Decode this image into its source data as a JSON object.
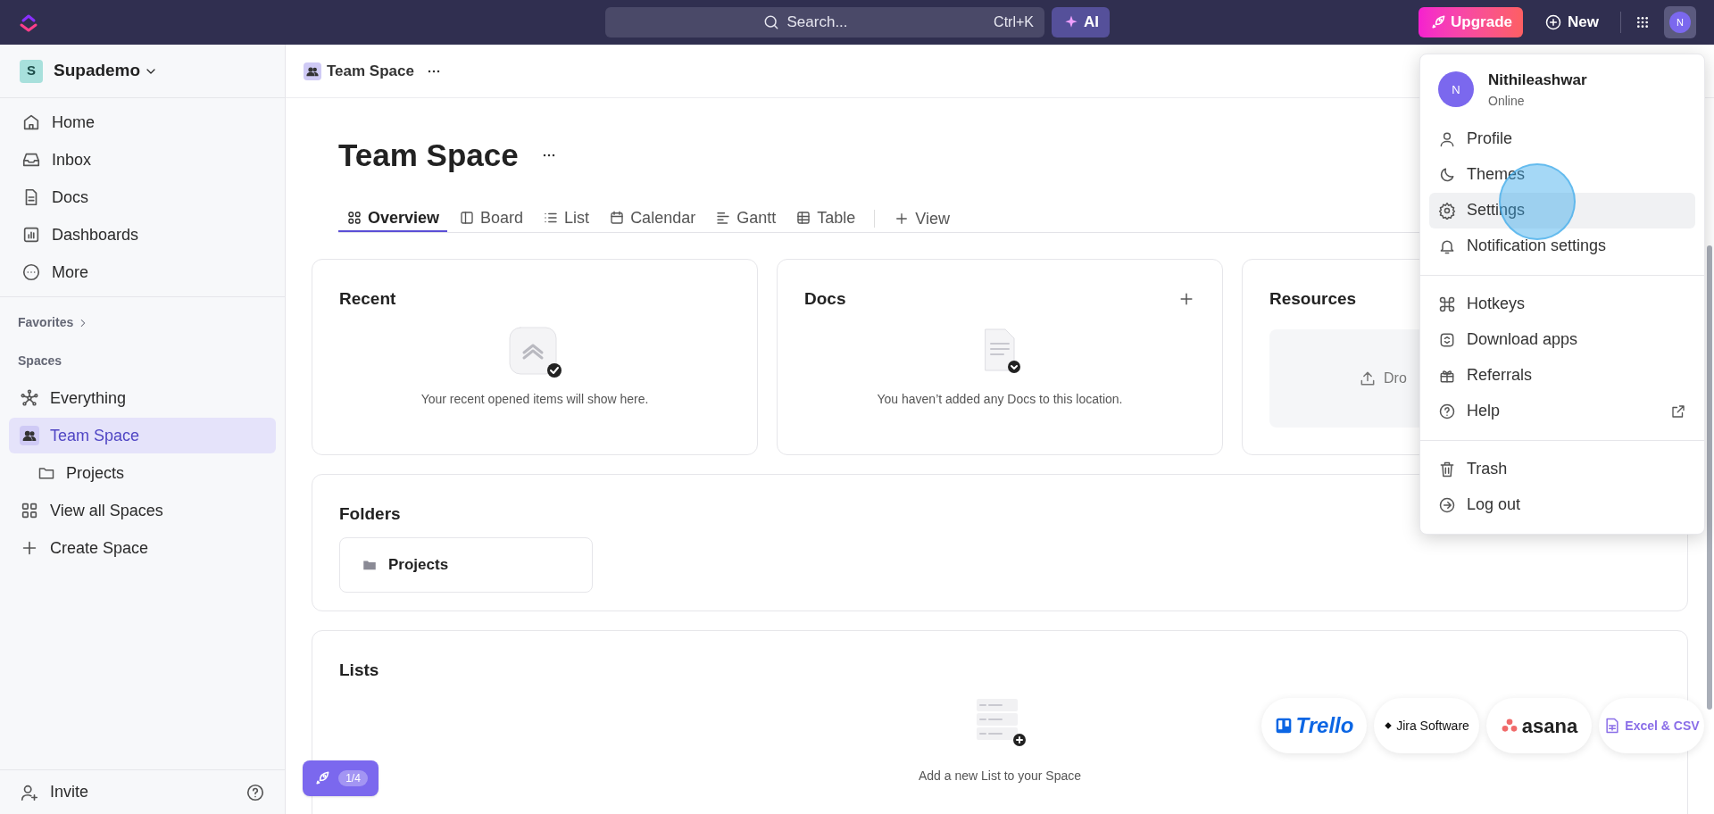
{
  "top_bar": {
    "search": {
      "placeholder": "Search...",
      "shortcut": "Ctrl+K"
    },
    "ai_button": "AI",
    "upgrade_button": "Upgrade",
    "new_button": "New",
    "avatar": "N"
  },
  "sidebar": {
    "workspace": {
      "initial": "S",
      "name": "Supademo"
    },
    "nav": [
      {
        "label": "Home"
      },
      {
        "label": "Inbox"
      },
      {
        "label": "Docs"
      },
      {
        "label": "Dashboards"
      },
      {
        "label": "More"
      }
    ],
    "favorites": "Favorites",
    "spaces_label": "Spaces",
    "spaces": [
      {
        "label": "Everything",
        "selected": false
      },
      {
        "label": "Team Space",
        "selected": true,
        "children": [
          {
            "label": "Projects",
            "selected": false
          }
        ]
      },
      {
        "label": "View all Spaces",
        "selected": false
      },
      {
        "label": "Create Space",
        "selected": false
      }
    ],
    "invite": "Invite"
  },
  "breadcrumb": "Team Space",
  "title": "Team Space",
  "tabs": [
    {
      "label": "Overview",
      "selected": true
    },
    {
      "label": "Board",
      "selected": false
    },
    {
      "label": "List",
      "selected": false
    },
    {
      "label": "Calendar",
      "selected": false
    },
    {
      "label": "Gantt",
      "selected": false
    },
    {
      "label": "Table",
      "selected": false
    }
  ],
  "add_view": "View",
  "cards": [
    {
      "title": "Recent",
      "message": "Your recent opened items will show here."
    },
    {
      "title": "Docs",
      "message": "You haven’t added any Docs to this location."
    },
    {
      "title": "Resources",
      "message": "Dro"
    }
  ],
  "folders": {
    "title": "Folders",
    "items": [
      "Projects"
    ]
  },
  "lists": {
    "title": "Lists",
    "message": "Add a new List to your Space"
  },
  "import_buttons": [
    "Trello",
    "Jira Software",
    "asana",
    "Excel & CSV"
  ],
  "tour_badge": "1/4",
  "user_menu": {
    "name": "Nithileashwar",
    "status": "Online",
    "avatar": "N",
    "groups": [
      [
        {
          "label": "Profile",
          "selected": false
        },
        {
          "label": "Themes",
          "selected": false
        },
        {
          "label": "Settings",
          "selected": true
        },
        {
          "label": "Notification settings",
          "selected": false
        }
      ],
      [
        {
          "label": "Hotkeys",
          "selected": false
        },
        {
          "label": "Download apps",
          "selected": false
        },
        {
          "label": "Referrals",
          "selected": false
        },
        {
          "label": "Help",
          "selected": false,
          "external": true
        }
      ],
      [
        {
          "label": "Trash",
          "selected": false
        },
        {
          "label": "Log out",
          "selected": false
        }
      ]
    ]
  }
}
